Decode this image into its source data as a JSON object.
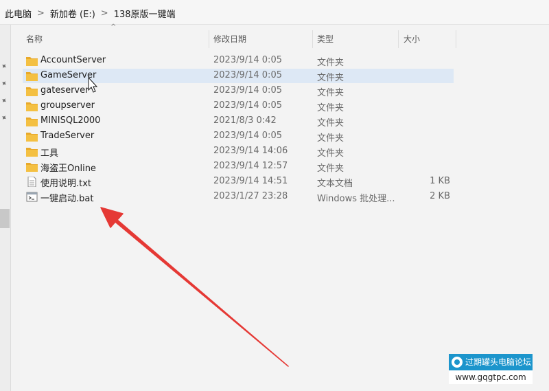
{
  "breadcrumb": [
    "此电脑",
    "新加卷 (E:)",
    "138原版一键端"
  ],
  "breadcrumb_separator": ">",
  "columns": {
    "name": "名称",
    "modified": "修改日期",
    "type": "类型",
    "size": "大小"
  },
  "files": [
    {
      "name": "AccountServer",
      "date": "2023/9/14 0:05",
      "type": "文件夹",
      "size": "",
      "icon": "folder-icon"
    },
    {
      "name": "GameServer",
      "date": "2023/9/14 0:05",
      "type": "文件夹",
      "size": "",
      "icon": "folder-icon",
      "selected": true
    },
    {
      "name": "gateserver",
      "date": "2023/9/14 0:05",
      "type": "文件夹",
      "size": "",
      "icon": "folder-icon"
    },
    {
      "name": "groupserver",
      "date": "2023/9/14 0:05",
      "type": "文件夹",
      "size": "",
      "icon": "folder-icon"
    },
    {
      "name": "MINISQL2000",
      "date": "2021/8/3 0:42",
      "type": "文件夹",
      "size": "",
      "icon": "folder-icon"
    },
    {
      "name": "TradeServer",
      "date": "2023/9/14 0:05",
      "type": "文件夹",
      "size": "",
      "icon": "folder-icon"
    },
    {
      "name": "工具",
      "date": "2023/9/14 14:06",
      "type": "文件夹",
      "size": "",
      "icon": "folder-icon"
    },
    {
      "name": "海盗王Online",
      "date": "2023/9/14 12:57",
      "type": "文件夹",
      "size": "",
      "icon": "folder-icon"
    },
    {
      "name": "使用说明.txt",
      "date": "2023/9/14 14:51",
      "type": "文本文档",
      "size": "1 KB",
      "icon": "text-file-icon"
    },
    {
      "name": "一键启动.bat",
      "date": "2023/1/27 23:28",
      "type": "Windows 批处理...",
      "size": "2 KB",
      "icon": "batch-file-icon"
    }
  ],
  "colors": {
    "selection": "#dde8f5",
    "folder": "#f4c042",
    "arrow": "#e53935",
    "watermark": "#1c95cc"
  },
  "watermark": {
    "title": "过期罐头电脑论坛",
    "url": "www.gqgtpc.com"
  }
}
